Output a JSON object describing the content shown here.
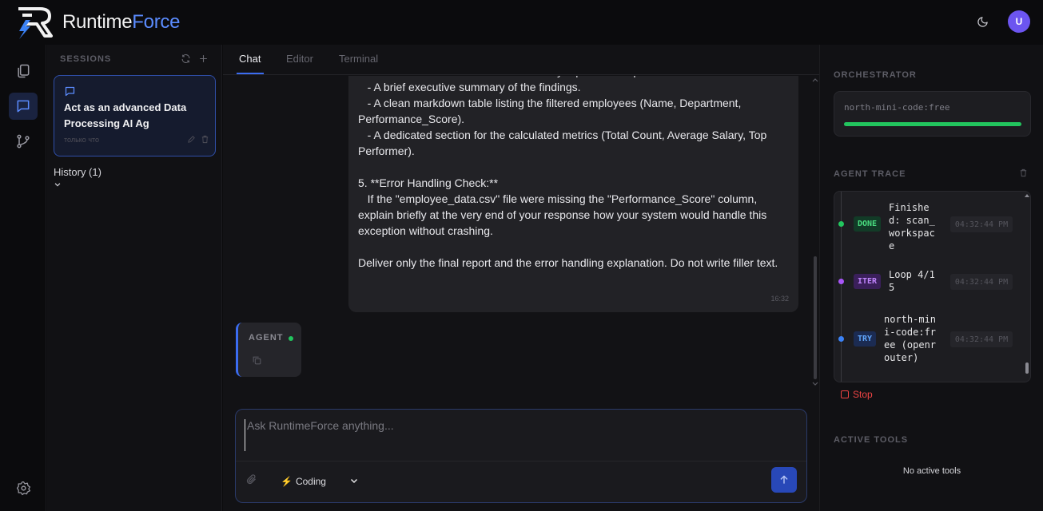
{
  "app": {
    "brand_left": "Runtime",
    "brand_right": "Force",
    "avatar_initial": "U",
    "accent": "#3b6cf0"
  },
  "rail": {
    "items": [
      "files-icon",
      "chat-icon",
      "git-branch-icon",
      "settings-icon"
    ],
    "active": "chat-icon"
  },
  "sessions": {
    "heading": "SESSIONS",
    "current": {
      "title": "Act as an advanced Data Processing AI Ag",
      "time": "только что"
    },
    "history_label": "History (1)"
  },
  "tabs": [
    {
      "label": "Chat",
      "active": true
    },
    {
      "label": "Editor",
      "active": false
    },
    {
      "label": "Terminal",
      "active": false
    }
  ],
  "chat": {
    "user_message": "- Create a markdown-formatted summary report. The report must include:\n   - A brief executive summary of the findings.\n   - A clean markdown table listing the filtered employees (Name, Department, Performance_Score).\n   - A dedicated section for the calculated metrics (Total Count, Average Salary, Top Performer).\n\n5. **Error Handling Check:**\n   If the \"employee_data.csv\" file were missing the \"Performance_Score\" column, explain briefly at the very end of your response how your system would handle this exception without crashing.\n\nDeliver only the final report and the error handling explanation. Do not write filler text.",
    "user_timestamp": "16:32",
    "agent_label": "AGENT"
  },
  "composer": {
    "placeholder": "Ask RuntimeForce anything...",
    "value": "",
    "mode_value": "Coding",
    "mode_icon": "⚡"
  },
  "right": {
    "orchestrator_heading": "ORCHESTRATOR",
    "orchestrator_model": "north-mini-code:free",
    "orchestrator_progress": 1.0,
    "trace_heading": "AGENT TRACE",
    "trace": [
      {
        "badge": "DONE",
        "text": "Finished: scan_workspace",
        "time": "04:32:44 PM",
        "color": "#22c55e"
      },
      {
        "badge": "ITER",
        "text": "Loop 4/15",
        "time": "04:32:44 PM",
        "color": "#a855f7"
      },
      {
        "badge": "TRY",
        "text": "north-mini-code:free (openrouter)",
        "time": "04:32:44 PM",
        "color": "#3b82f6"
      }
    ],
    "stop_label": "Stop",
    "tools_heading": "ACTIVE TOOLS",
    "no_tools": "No active tools"
  }
}
